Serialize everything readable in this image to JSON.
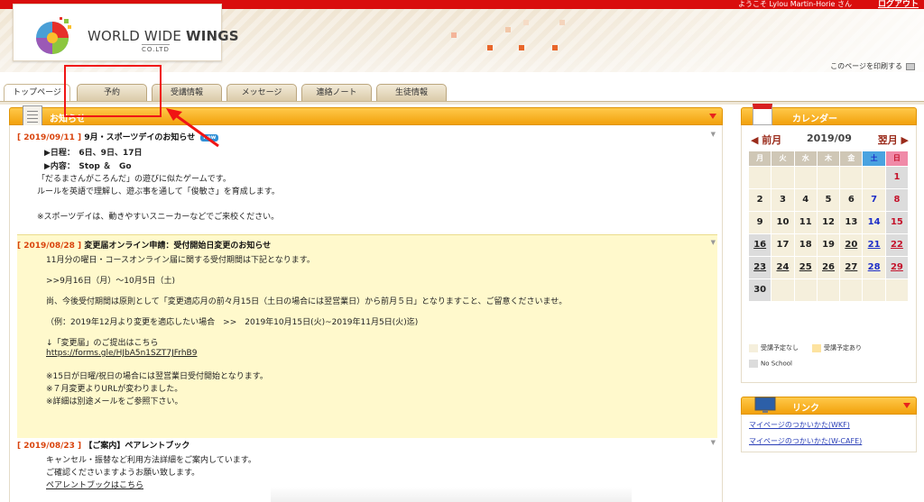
{
  "header": {
    "welcome": "ようこそ Lylou Martin-Horie さん",
    "logout": "ログアウト",
    "logo_main": "WORLD WIDE",
    "logo_tail": "WINGS",
    "logo_sub": "CO.LTD",
    "print_link": "このページを印刷する"
  },
  "tabs": [
    {
      "label": "トップページ",
      "active": true
    },
    {
      "label": "予約",
      "active": false
    },
    {
      "label": "受講情報",
      "active": false
    },
    {
      "label": "メッセージ",
      "active": false
    },
    {
      "label": "連絡ノート",
      "active": false
    },
    {
      "label": "生徒情報",
      "active": false
    }
  ],
  "main": {
    "title": "お知らせ",
    "news": [
      {
        "date": "[ 2019/09/11 ]",
        "title": "9月・スポーツデイのお知らせ",
        "badge": "new",
        "lines": [
          "▶日程：　6日、9日、17日",
          "▶内容：　Stop ＆　Go",
          "「だるまさんがころんだ」の遊びに似たゲームです。",
          "ルールを英語で理解し、遊ぶ事を通して「俊敏さ」を育成します。",
          "",
          "※スポーツデイは、動きやすいスニーカーなどでご来校ください。"
        ]
      },
      {
        "date": "[ 2019/08/28 ]",
        "title": "変更届オンライン申請：受付開始日変更のお知らせ",
        "lines": [
          "11月分の曜日・コースオンライン届に関する受付期間は下記となります。",
          "",
          ">>9月16日（月）～10月5日（土)",
          "",
          "尚、今後受付期間は原則として「変更適応月の前々月15日（土日の場合には翌営業日）から前月５日」となりますこと、ご留意くださいませ。",
          "",
          "（例：2019年12月より変更を適応したい場合　>>　2019年10月15日(火)~2019年11月5日(火)迄)",
          "",
          "↓「変更届」のご提出はこちら"
        ],
        "link": "https://forms.gle/HJbA5n1SZT7JFrhB9",
        "lines_after": [
          "",
          "※15日が日曜/祝日の場合には翌営業日受付開始となります。",
          "※７月変更よりURLが変わりました。",
          "※詳細は別途メールをご参照下さい。"
        ]
      },
      {
        "date": "[ 2019/08/23 ]",
        "title": "【ご案内】ペアレントブック",
        "lines": [
          "キャンセル・振替など利用方法詳細をご案内しています。",
          "ご確認くださいますようお願い致します。"
        ],
        "link": "ペアレントブックはこちら"
      }
    ]
  },
  "calendar": {
    "title": "カレンダー",
    "prev": "◀ 前月",
    "month": "2019/09",
    "next": "翌月 ▶",
    "weekdays": [
      "月",
      "火",
      "水",
      "木",
      "金",
      "土",
      "日"
    ],
    "weeks": [
      [
        "",
        "",
        "",
        "",
        "",
        "",
        "1"
      ],
      [
        "2",
        "3",
        "4",
        "5",
        "6",
        "7",
        "8"
      ],
      [
        "9",
        "10",
        "11",
        "12",
        "13",
        "14",
        "15"
      ],
      [
        "16",
        "17",
        "18",
        "19",
        "20",
        "21",
        "22"
      ],
      [
        "23",
        "24",
        "25",
        "26",
        "27",
        "28",
        "29"
      ],
      [
        "30",
        "",
        "",
        "",
        "",
        "",
        ""
      ]
    ],
    "no_school": [
      "1",
      "8",
      "15",
      "16",
      "22",
      "23",
      "29",
      "30"
    ],
    "underlined": [
      "16",
      "20",
      "21",
      "22",
      "23",
      "24",
      "25",
      "26",
      "27",
      "28",
      "29"
    ],
    "legend": [
      {
        "label": "受講予定なし",
        "color": "#f5efdc"
      },
      {
        "label": "受講予定あり",
        "color": "#fde3a0"
      },
      {
        "label": "No School",
        "color": "#dcdcdc"
      }
    ]
  },
  "links": {
    "title": "リンク",
    "items": [
      "マイページのつかいかた(WKF)",
      "マイページのつかいかた(W-CAFE)"
    ]
  },
  "colors": {
    "topbar": "#d90d0d",
    "panel_header": "#f2a10c",
    "date": "#d9440d",
    "annotation": "#f01414"
  }
}
